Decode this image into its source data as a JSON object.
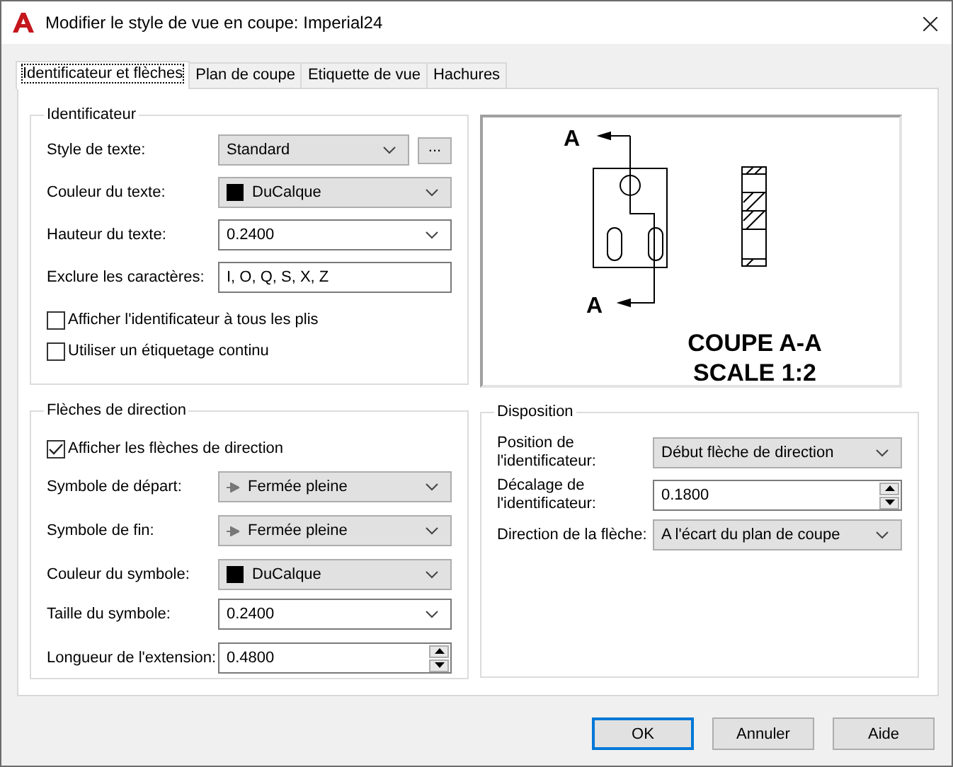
{
  "window": {
    "title": "Modifier le style de vue en coupe: Imperial24"
  },
  "tabs": [
    {
      "label": "Identificateur et flèches",
      "selected": true
    },
    {
      "label": "Plan de coupe",
      "selected": false
    },
    {
      "label": "Etiquette de vue",
      "selected": false
    },
    {
      "label": "Hachures",
      "selected": false
    }
  ],
  "identifier": {
    "title": "Identificateur",
    "rows": [
      {
        "kind": "combo",
        "label": "Style de texte:",
        "value": "Standard",
        "extra_button": "..."
      },
      {
        "kind": "combo",
        "label": "Couleur du texte:",
        "value": "DuCalque",
        "color": "#000000"
      },
      {
        "kind": "editcombo",
        "label": "Hauteur du texte:",
        "value": "0.2400"
      },
      {
        "kind": "text",
        "label": "Exclure les caractères:",
        "value": "I, O, Q, S, X, Z"
      },
      {
        "kind": "checkbox",
        "label": "Afficher l'identificateur à tous les plis",
        "checked": false
      },
      {
        "kind": "checkbox",
        "label": "Utiliser un étiquetage continu",
        "checked": false
      }
    ]
  },
  "direction_arrows": {
    "title": "Flèches de direction",
    "rows": [
      {
        "kind": "checkbox",
        "label": "Afficher les flèches de direction",
        "checked": true
      },
      {
        "kind": "arrowcombo",
        "label": "Symbole de départ:",
        "value": "Fermée pleine"
      },
      {
        "kind": "arrowcombo",
        "label": "Symbole de fin:",
        "value": "Fermée pleine"
      },
      {
        "kind": "combo",
        "label": "Couleur du symbole:",
        "value": "DuCalque",
        "color": "#000000"
      },
      {
        "kind": "editcombo",
        "label": "Taille du symbole:",
        "value": "0.2400"
      },
      {
        "kind": "spin",
        "label": "Longueur de l'extension:",
        "value": "0.4800"
      }
    ]
  },
  "preview": {
    "markers": [
      "A",
      "A"
    ],
    "caption": "COUPE A-A",
    "scale": "SCALE 1:2"
  },
  "placement": {
    "title": "Disposition",
    "rows": [
      {
        "kind": "combo",
        "label": "Position de l'identificateur:",
        "value": "Début flèche de direction"
      },
      {
        "kind": "spin",
        "label": "Décalage de l'identificateur:",
        "value": "0.1800"
      },
      {
        "kind": "combo",
        "label": "Direction de la flèche:",
        "value": "A l'écart du plan de coupe"
      }
    ]
  },
  "buttons": [
    {
      "label": "OK",
      "default": true
    },
    {
      "label": "Annuler",
      "default": false
    },
    {
      "label": "Aide",
      "default": false
    }
  ]
}
